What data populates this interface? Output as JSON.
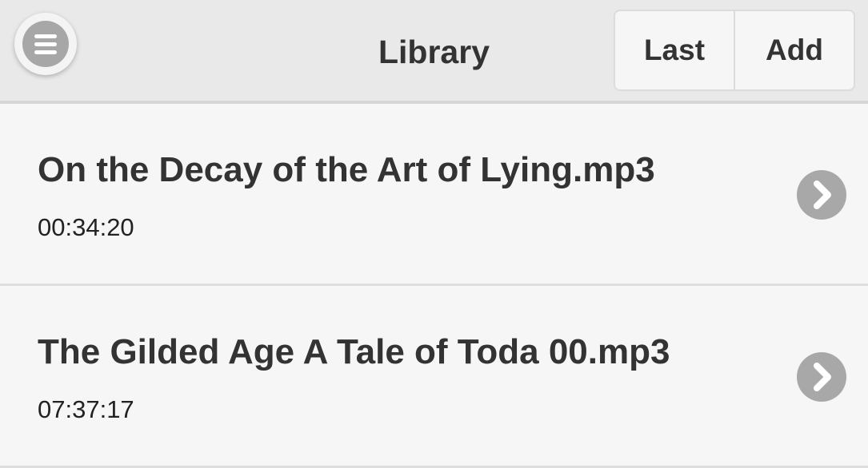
{
  "header": {
    "title": "Library",
    "buttons": {
      "last_label": "Last",
      "add_label": "Add"
    },
    "menu_icon": "hamburger-menu-icon"
  },
  "list": {
    "items": [
      {
        "title": "On the Decay of the Art of Lying.mp3",
        "duration": "00:34:20",
        "icon": "chevron-right-icon"
      },
      {
        "title": "The Gilded Age A Tale of Toda 00.mp3",
        "duration": "07:37:17",
        "icon": "chevron-right-icon"
      }
    ]
  },
  "colors": {
    "header_bg": "#e9e9e9",
    "list_bg": "#f6f6f6",
    "icon_gray": "#a8a8a8",
    "text": "#333333"
  }
}
